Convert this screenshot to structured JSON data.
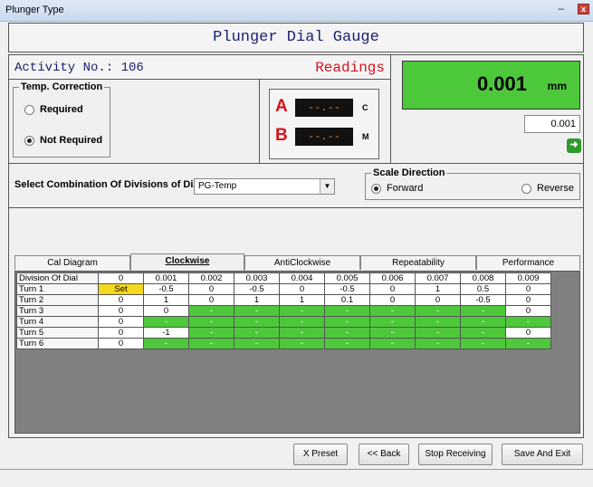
{
  "window": {
    "title": "Plunger Type",
    "minimize": "–",
    "close": "x"
  },
  "header": {
    "title": "Plunger Dial Gauge",
    "activity": "Activity No.: 106",
    "readings": "Readings"
  },
  "temp_correction": {
    "legend": "Temp. Correction",
    "options": [
      {
        "label": "Required",
        "selected": false
      },
      {
        "label": "Not Required",
        "selected": true
      }
    ]
  },
  "ab_display": {
    "a_label": "A",
    "a_value": "--.--",
    "a_unit": "C",
    "b_label": "B",
    "b_value": "--.--",
    "b_unit": "M"
  },
  "main_display": {
    "value": "0.001",
    "unit": "mm",
    "input_value": "0.001"
  },
  "combination": {
    "label": "Select Combination Of Divisions of Dial :",
    "selected": "PG-Temp"
  },
  "scale_direction": {
    "legend": "Scale Direction",
    "options": [
      {
        "label": "Forward",
        "selected": true
      },
      {
        "label": "Reverse",
        "selected": false
      }
    ]
  },
  "tabs": [
    "Cal Diagram",
    "Clockwise",
    "AntiClockwise",
    "Repeatability",
    "Performance"
  ],
  "active_tab": "Clockwise",
  "grid": {
    "header": [
      "Division Of Dial",
      "0",
      "0.001",
      "0.002",
      "0.003",
      "0.004",
      "0.005",
      "0.006",
      "0.007",
      "0.008",
      "0.009"
    ],
    "rows": [
      [
        "Turn 1",
        "Set",
        "-0.5",
        "0",
        "-0.5",
        "0",
        "-0.5",
        "0",
        "1",
        "0.5",
        "0"
      ],
      [
        "Turn 2",
        "0",
        "1",
        "0",
        "1",
        "1",
        "0.1",
        "0",
        "0",
        "-0.5",
        "0"
      ],
      [
        "Turn 3",
        "0",
        "0",
        "-",
        "-",
        "-",
        "-",
        "-",
        "-",
        "-",
        "0"
      ],
      [
        "Turn 4",
        "0",
        "-",
        "-",
        "-",
        "-",
        "-",
        "-",
        "-",
        "-",
        "-"
      ],
      [
        "Turn 5",
        "0",
        "-1",
        "-",
        "-",
        "-",
        "-",
        "-",
        "-",
        "-",
        "0"
      ],
      [
        "Turn 6",
        "0",
        "-",
        "-",
        "-",
        "-",
        "-",
        "-",
        "-",
        "-",
        "-"
      ]
    ]
  },
  "buttons": {
    "preset": "X Preset",
    "back": "<< Back",
    "stop": "Stop Receiving",
    "save_exit": "Save And Exit"
  },
  "colors": {
    "green": "#4ec83b",
    "red": "#d2141c",
    "yellow": "#f5d81c",
    "navy": "#1a1f6e"
  }
}
